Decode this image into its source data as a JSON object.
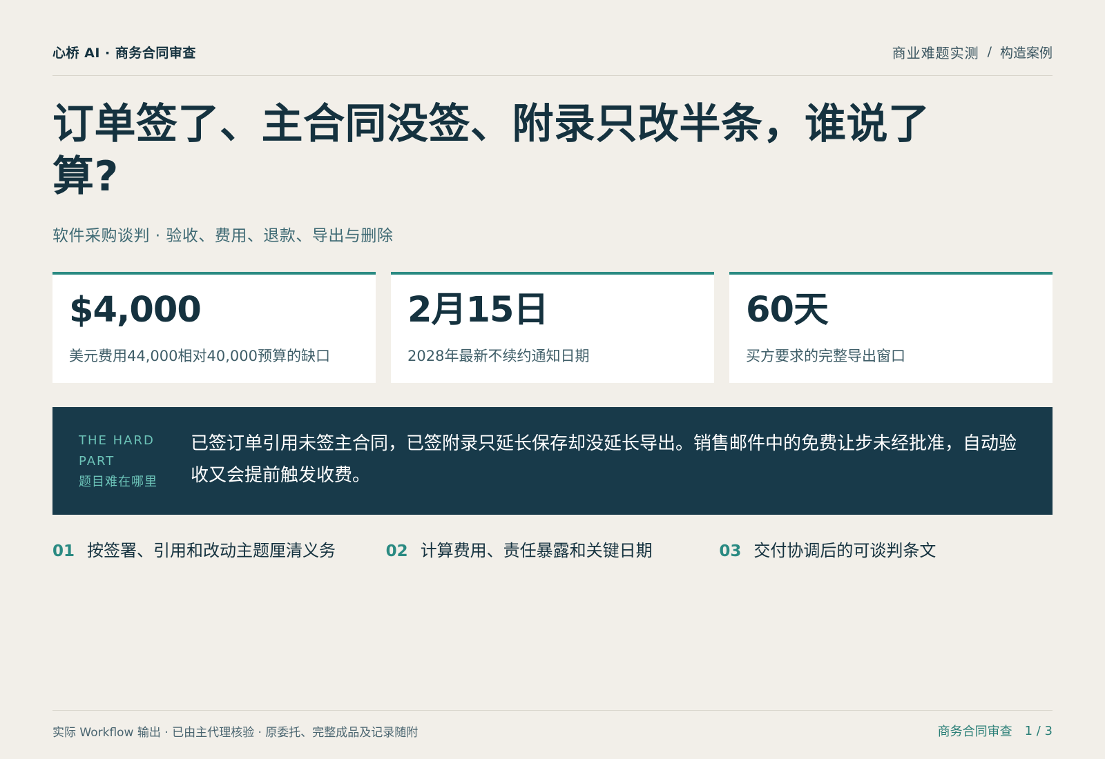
{
  "header": {
    "brand": "心桥 AI · 商务合同审查",
    "crumb_primary": "商业难题实测",
    "crumb_separator": "/",
    "crumb_secondary": "构造案例"
  },
  "title": "订单签了、主合同没签、附录只改半条，谁说了算?",
  "subtitle": "软件采购谈判 · 验收、费用、退款、导出与删除",
  "stats": [
    {
      "value": "$4,000",
      "label": "美元费用44,000相对40,000预算的缺口"
    },
    {
      "value": "2月15日",
      "label": "2028年最新不续约通知日期"
    },
    {
      "value": "60天",
      "label": "买方要求的完整导出窗口"
    }
  ],
  "hard_part": {
    "tag_en": "THE HARD PART",
    "tag_zh": "题目难在哪里",
    "text": "已签订单引用未签主合同，已签附录只延长保存却没延长导出。销售邮件中的免费让步未经批准，自动验收又会提前触发收费。"
  },
  "steps": [
    {
      "num": "01",
      "text": "按签署、引用和改动主题厘清义务"
    },
    {
      "num": "02",
      "text": "计算费用、责任暴露和关键日期"
    },
    {
      "num": "03",
      "text": "交付协调后的可谈判条文"
    }
  ],
  "footer": {
    "note": "实际 Workflow 输出 · 已由主代理核验 · 原委托、完整成品及记录随附",
    "section": "商务合同审查",
    "page": "1 / 3"
  },
  "colors": {
    "background": "#f2efe9",
    "ink": "#15323f",
    "accent": "#2a8a82",
    "panel": "#183a4a"
  }
}
